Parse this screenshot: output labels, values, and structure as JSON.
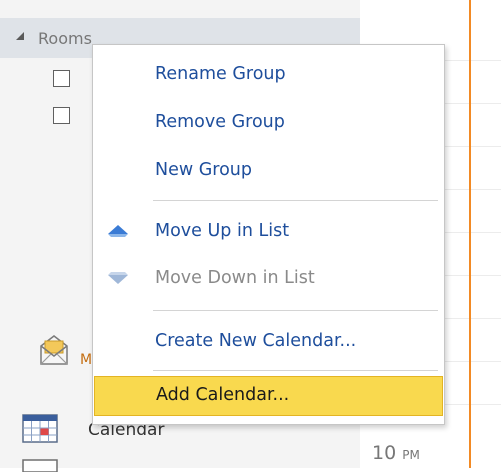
{
  "navigation": {
    "group_title": "Rooms",
    "mail_label": "M",
    "calendar_label": "Calendar"
  },
  "calendar_grid": {
    "time_label": "10",
    "time_suffix": "PM"
  },
  "context_menu": {
    "items": [
      {
        "label": "Rename Group",
        "enabled": true
      },
      {
        "label": "Remove Group",
        "enabled": true
      },
      {
        "label": "New Group",
        "enabled": true
      },
      {
        "label": "Move Up in List",
        "enabled": true,
        "icon": "arrow-up-icon"
      },
      {
        "label": "Move Down in List",
        "enabled": false,
        "icon": "arrow-down-icon"
      },
      {
        "label": "Create New Calendar...",
        "enabled": true
      },
      {
        "label": "Add Calendar...",
        "enabled": true,
        "highlighted": true
      }
    ]
  },
  "colors": {
    "menu_text": "#1e4e9c",
    "disabled_text": "#8a8a8a",
    "highlight": "#f9d94e",
    "current_time_line": "#f28a24"
  }
}
